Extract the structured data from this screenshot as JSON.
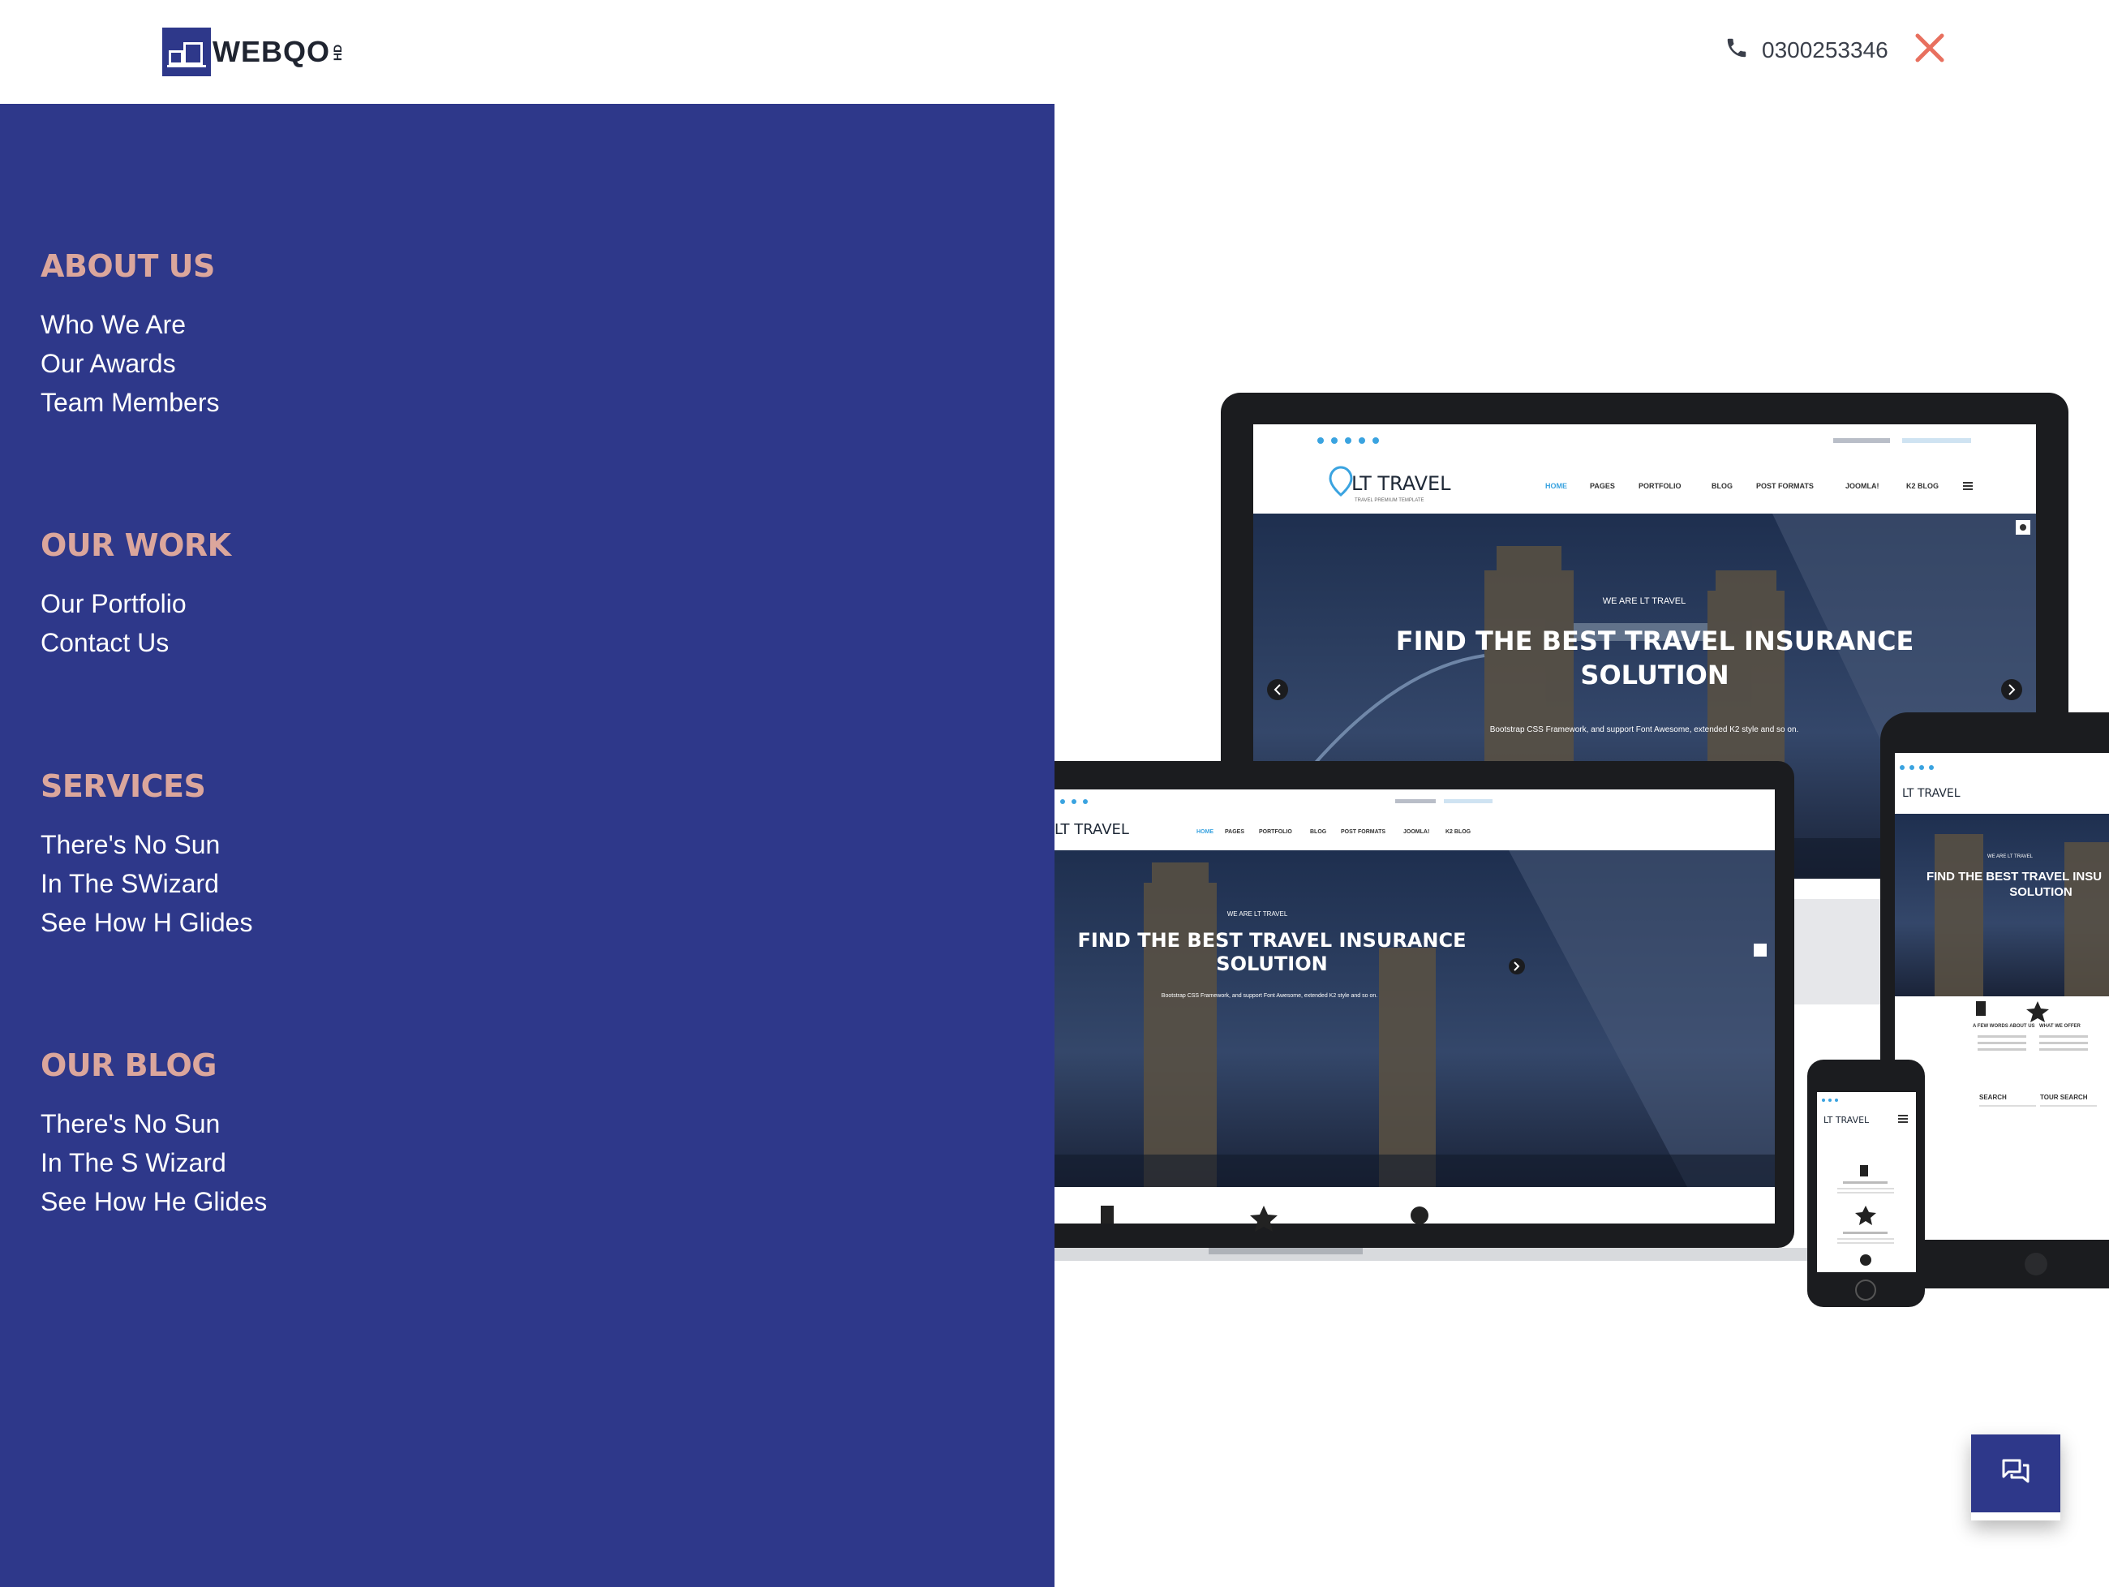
{
  "header": {
    "logo_text": "WEBQO",
    "logo_sub": "HD",
    "phone_icon": "phone-icon",
    "phone_number": "0300253346",
    "close_icon": "close-icon"
  },
  "menu": {
    "sections": [
      {
        "heading": "ABOUT US",
        "links": [
          "Who We Are",
          "Our Awards",
          "Team Members"
        ]
      },
      {
        "heading": "OUR WORK",
        "links": [
          "Our Portfolio",
          "Contact Us"
        ]
      },
      {
        "heading": "SERVICES",
        "links": [
          "There's No Sun",
          "In The SWizard",
          "See How H Glides"
        ]
      },
      {
        "heading": "OUR BLOG",
        "links": [
          "There's No Sun",
          "In The S Wizard",
          "See How He Glides"
        ]
      }
    ]
  },
  "hero": {
    "brand": "LT TRAVEL",
    "brand_tagline": "TRAVEL PREMIUM TEMPLATE",
    "eyebrow": "WE ARE LT TRAVEL",
    "headline_line1": "FIND THE BEST TRAVEL INSURANCE",
    "headline_line2": "SOLUTION",
    "subtext": "Bootstrap CSS Framework, and support Font Awesome, extended K2 style and so on.",
    "nav_items": [
      "HOME",
      "PAGES",
      "PORTFOLIO",
      "BLOG",
      "POST FORMATS",
      "JOOMLA!",
      "K2 BLOG"
    ],
    "tablet_headline_line1": "FIND THE BEST TRAVEL INSU",
    "tablet_headline_line2": "SOLUTION",
    "search_label": "SEARCH",
    "tour_search_label": "TOUR SEARCH",
    "about_label": "A FEW WORDS ABOUT US",
    "offer_label": "WHAT WE OFFER"
  },
  "chat": {
    "icon": "chat-icon"
  },
  "colors": {
    "brand_navy": "#2e388a",
    "heading_peach": "#dba69c",
    "close_red": "#e8705f",
    "menu_text": "#ffffff"
  }
}
